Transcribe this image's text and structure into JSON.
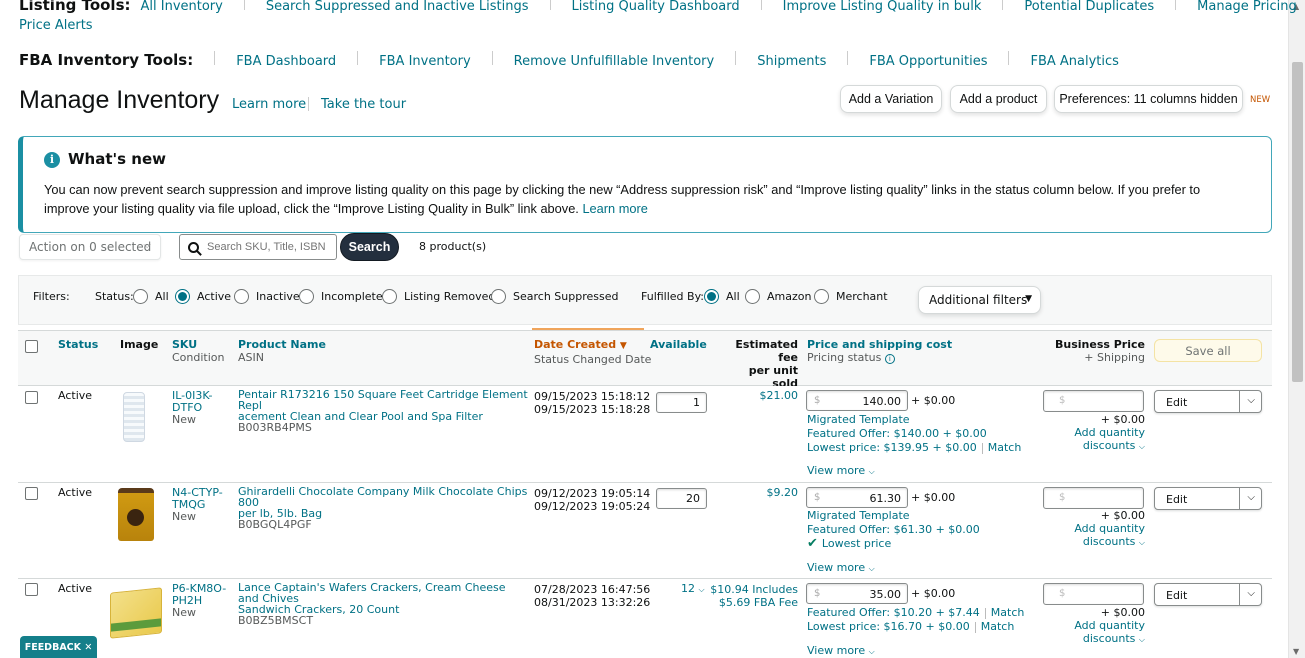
{
  "listing_tools": {
    "title": "Listing Tools:",
    "links": [
      "All Inventory",
      "Search Suppressed and Inactive Listings",
      "Listing Quality Dashboard",
      "Improve Listing Quality in bulk",
      "Potential Duplicates",
      "Manage Pricing"
    ],
    "price_alerts": "Price Alerts"
  },
  "fba_tools": {
    "title": "FBA Inventory Tools:",
    "links": [
      "FBA Dashboard",
      "FBA Inventory",
      "Remove Unfulfillable Inventory",
      "Shipments",
      "FBA Opportunities",
      "FBA Analytics"
    ]
  },
  "header": {
    "title": "Manage Inventory",
    "learn_more": "Learn more",
    "take_tour": "Take the tour",
    "add_variation": "Add a Variation",
    "add_product": "Add a product",
    "preferences": "Preferences: 11 columns hidden",
    "new_badge": "NEW"
  },
  "whats_new": {
    "title": "What's new",
    "body": "You can now prevent search suppression and improve listing quality on this page by clicking the new “Address suppression risk” and “Improve listing quality” links in the status column below. If you prefer to improve your listing quality via file upload, click the “Improve Listing Quality in Bulk” link above.",
    "link": "Learn more"
  },
  "toolbar": {
    "action_label": "Action on 0 selected",
    "search_placeholder": "Search SKU, Title, ISBN",
    "search_button": "Search",
    "product_count": "8 product(s)"
  },
  "filters": {
    "label": "Filters:",
    "status_label": "Status:",
    "status_options": [
      "All",
      "Active",
      "Inactive",
      "Incomplete",
      "Listing Removed",
      "Search Suppressed"
    ],
    "status_selected": "Active",
    "fulfilled_label": "Fulfilled By:",
    "fulfilled_options": [
      "All",
      "Amazon",
      "Merchant"
    ],
    "fulfilled_selected": "All",
    "additional": "Additional filters"
  },
  "columns": {
    "status": "Status",
    "image": "Image",
    "sku": "SKU",
    "condition": "Condition",
    "product_name": "Product Name",
    "asin": "ASIN",
    "date_created": "Date Created",
    "status_changed": "Status Changed Date",
    "available": "Available",
    "est_fee": "Estimated fee",
    "per_unit": "per unit sold",
    "price_ship": "Price and shipping cost",
    "pricing_status": "Pricing status",
    "business_price": "Business Price",
    "plus_shipping": "+ Shipping",
    "save_all": "Save all"
  },
  "rows": [
    {
      "status": "Active",
      "sku1": "IL-0I3K-",
      "sku2": "DTFO",
      "condition": "New",
      "name1": "Pentair R173216 150 Square Feet Cartridge Element Repl",
      "name2": "acement Clean and Clear Pool and Spa Filter",
      "asin": "B003RB4PMS",
      "date_created": "09/15/2023 15:18:12",
      "status_changed": "09/15/2023 15:18:28",
      "available": "1",
      "fee": "$21.00",
      "price": "140.00",
      "shipping": "+ $0.00",
      "line1": "Migrated Template",
      "line2": "Featured Offer: $140.00 + $0.00",
      "line3": "Lowest price: $139.95 + $0.00",
      "match": "Match",
      "view_more": "View more",
      "biz_shipping": "+ $0.00",
      "add_qty": "Add quantity",
      "discounts": "discounts",
      "edit": "Edit"
    },
    {
      "status": "Active",
      "sku1": "N4-CTYP-",
      "sku2": "TMQG",
      "condition": "New",
      "name1": "Ghirardelli Chocolate Company Milk Chocolate Chips 800",
      "name2": "per lb, 5lb. Bag",
      "asin": "B0BGQL4PGF",
      "date_created": "09/12/2023 19:05:14",
      "status_changed": "09/12/2023 19:05:24",
      "available": "20",
      "fee": "$9.20",
      "price": "61.30",
      "shipping": "+ $0.00",
      "line1": "Migrated Template",
      "line2": "Featured Offer: $61.30 + $0.00",
      "line3": "Lowest price",
      "view_more": "View more",
      "biz_shipping": "+ $0.00",
      "add_qty": "Add quantity",
      "discounts": "discounts",
      "edit": "Edit"
    },
    {
      "status": "Active",
      "sku1": "P6-KM8O-",
      "sku2": "PH2H",
      "condition": "New",
      "name1": "Lance Captain's Wafers Crackers, Cream Cheese and Chives",
      "name2": "Sandwich Crackers, 20 Count",
      "asin": "B0BZ5BMSCT",
      "date_created": "07/28/2023 16:47:56",
      "status_changed": "08/31/2023 13:32:26",
      "available": "12",
      "fee1": "$10.94 Includes",
      "fee2": "$5.69 FBA Fee",
      "price": "35.00",
      "shipping": "+ $0.00",
      "line2": "Featured Offer: $10.20 + $7.44",
      "line3": "Lowest price: $16.70 + $0.00",
      "match": "Match",
      "view_more": "View more",
      "biz_shipping": "+ $0.00",
      "add_qty": "Add quantity",
      "discounts": "discounts",
      "edit": "Edit"
    }
  ],
  "currency_symbol": "$",
  "feedback": "FEEDBACK"
}
